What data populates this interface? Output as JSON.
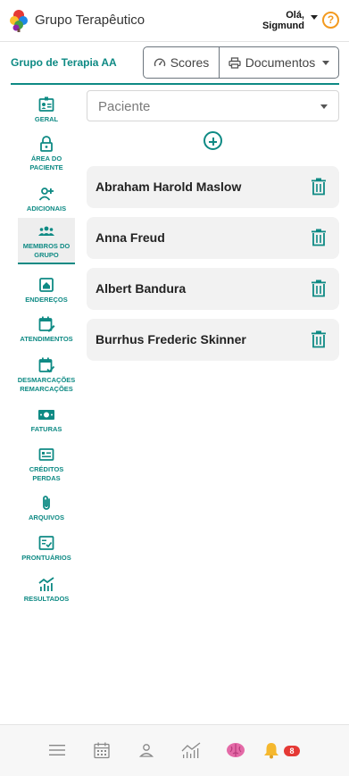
{
  "app": {
    "title": "Grupo Terapêutico"
  },
  "user": {
    "greeting": "Olá,",
    "name": "Sigmund"
  },
  "group": {
    "name": "Grupo de Terapia AA"
  },
  "actions": {
    "scores_label": "Scores",
    "documents_label": "Documentos"
  },
  "nav": {
    "items": [
      {
        "label": "GERAL",
        "icon": "id-card-icon"
      },
      {
        "label": "ÁREA DO PACIENTE",
        "icon": "lock-icon"
      },
      {
        "label": "ADICIONAIS",
        "icon": "person-add-icon"
      },
      {
        "label": "MEMBROS DO GRUPO",
        "icon": "group-icon",
        "active": true
      },
      {
        "label": "ENDEREÇOS",
        "icon": "home-icon"
      },
      {
        "label": "ATENDIMENTOS",
        "icon": "calendar-edit-icon"
      },
      {
        "label": "DESMARCAÇÕES REMARCAÇÕES",
        "icon": "calendar-check-icon"
      },
      {
        "label": "FATURAS",
        "icon": "money-icon"
      },
      {
        "label": "CRÉDITOS PERDAS",
        "icon": "credit-icon"
      },
      {
        "label": "ARQUIVOS",
        "icon": "paperclip-icon"
      },
      {
        "label": "PRONTUÁRIOS",
        "icon": "checklist-icon"
      },
      {
        "label": "RESULTADOS",
        "icon": "chart-icon"
      }
    ]
  },
  "patient_select": {
    "placeholder": "Paciente"
  },
  "members": [
    "Abraham Harold Maslow",
    "Anna Freud",
    "Albert Bandura",
    "Burrhus Frederic Skinner"
  ],
  "bottom_nav": {
    "items": [
      "menu-icon",
      "calendar-icon",
      "person-icon",
      "chart-icon",
      "brain-icon",
      "bell-icon"
    ],
    "notification_count": "8"
  },
  "colors": {
    "accent": "#0e8a84",
    "help": "#f39a1f",
    "badge": "#e53935"
  }
}
